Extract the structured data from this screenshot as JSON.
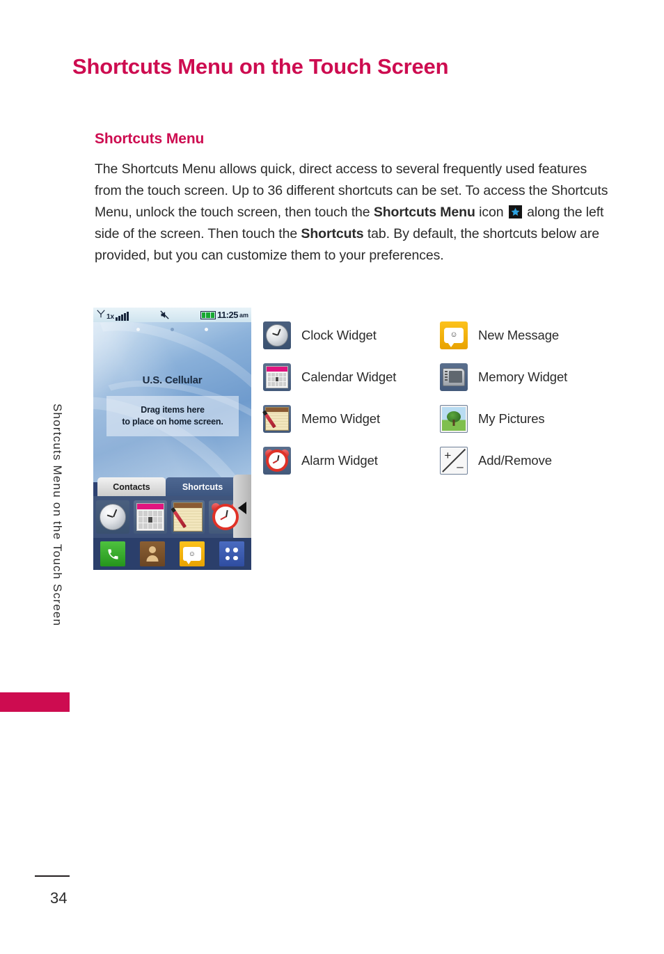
{
  "page": {
    "title": "Shortcuts Menu on the Touch Screen",
    "number": "34",
    "side_tab_text": "Shortcuts Menu on the Touch Screen",
    "accent_color": "#CD0C50"
  },
  "section": {
    "heading": "Shortcuts Menu",
    "paragraph_part1": "The Shortcuts Menu allows quick, direct access to several frequently used features from the touch screen. Up to 36 different shortcuts can be set. To access the Shortcuts Menu, unlock the touch screen, then touch the ",
    "bold1": "Shortcuts Menu",
    "paragraph_part2": " icon ",
    "paragraph_part3": " along the left side of the screen. Then touch the ",
    "bold2": "Shortcuts",
    "paragraph_part4": " tab. By default, the shortcuts below are provided, but you can customize them to your preferences."
  },
  "phone": {
    "status_bar": {
      "signal_icon": "antenna-icon",
      "network": "1x",
      "vibrate_icon": "vibrate-mute-icon",
      "battery_icon": "battery-icon",
      "time": "11:25",
      "meridiem": "am"
    },
    "carrier": "U.S. Cellular",
    "drop_zone_line1": "Drag items here",
    "drop_zone_line2": "to place on home screen.",
    "tabs": [
      {
        "label": "Contacts",
        "active": false
      },
      {
        "label": "Shortcuts",
        "active": true
      }
    ],
    "widget_row": [
      "clock-widget-icon",
      "calendar-widget-icon",
      "memo-widget-icon",
      "alarm-widget-icon"
    ],
    "dock": [
      "phone-icon",
      "contacts-icon",
      "message-icon",
      "menu-grid-icon"
    ],
    "side_handle_icon": "left-arrow-icon"
  },
  "shortcuts": {
    "left_column": [
      {
        "icon": "clock-widget-icon",
        "label": "Clock Widget"
      },
      {
        "icon": "calendar-widget-icon",
        "label": "Calendar Widget"
      },
      {
        "icon": "memo-widget-icon",
        "label": "Memo Widget"
      },
      {
        "icon": "alarm-widget-icon",
        "label": "Alarm Widget"
      }
    ],
    "right_column": [
      {
        "icon": "new-message-icon",
        "label": "New Message"
      },
      {
        "icon": "memory-widget-icon",
        "label": "Memory Widget"
      },
      {
        "icon": "my-pictures-icon",
        "label": "My Pictures"
      },
      {
        "icon": "add-remove-icon",
        "label": "Add/Remove"
      }
    ]
  }
}
